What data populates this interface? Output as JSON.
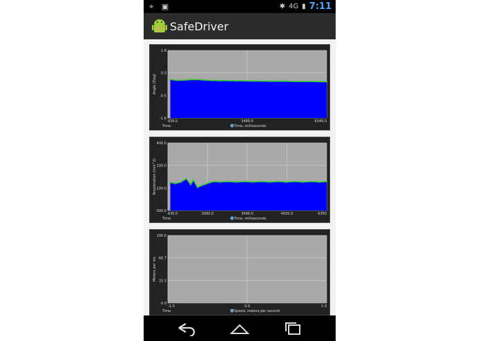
{
  "status_bar": {
    "left_icons": [
      "gps-icon",
      "image-icon"
    ],
    "network": "4G",
    "time": "7:11"
  },
  "action_bar": {
    "title": "SafeDriver",
    "icon": "android-icon"
  },
  "colors": {
    "fill": "#0000ff",
    "line": "#33cc33",
    "plot_bg": "#a9a9a9",
    "panel_bg": "#222222"
  },
  "navigation": {
    "buttons": [
      "back-icon",
      "home-icon",
      "recent-apps-icon"
    ]
  },
  "chart_data": [
    {
      "type": "area",
      "ylabel": "Angle (Deg)",
      "xlabel": "Time",
      "legend": "Time, milliseconds",
      "xlim": [
        630.0,
        6349.0
      ],
      "ylim": [
        -1.6,
        1.6
      ],
      "x_ticks": [
        "630.0",
        "3489.5",
        "6349.0"
      ],
      "y_ticks": [
        "1.6",
        "0.5",
        "-0.5",
        "-1.6"
      ],
      "x": [
        720,
        1000,
        1300,
        1600,
        1900,
        2200,
        2500,
        2800,
        3100,
        3400,
        3700,
        4000,
        4300,
        4600,
        4900,
        5200,
        5500,
        5800,
        6100,
        6349
      ],
      "values": [
        0.22,
        0.18,
        0.2,
        0.22,
        0.2,
        0.18,
        0.17,
        0.17,
        0.16,
        0.16,
        0.15,
        0.15,
        0.14,
        0.14,
        0.14,
        0.13,
        0.13,
        0.13,
        0.12,
        0.12
      ]
    },
    {
      "type": "area",
      "ylabel": "Acceleration (m/s^2)",
      "xlabel": "Time",
      "legend": "Time, milliseconds",
      "xlim": [
        630.0,
        6350.0
      ],
      "ylim": [
        -300.0,
        400.0
      ],
      "x_ticks": [
        "630.0",
        "2060.0",
        "3490.0",
        "4920.0",
        "6350"
      ],
      "y_ticks": [
        "400.0",
        "100.0",
        "-100.0",
        "-300.0"
      ],
      "x": [
        720,
        900,
        1100,
        1300,
        1450,
        1550,
        1700,
        1850,
        2000,
        2150,
        2300,
        2500,
        2800,
        3100,
        3400,
        3700,
        4000,
        4300,
        4600,
        4900,
        5200,
        5500,
        5800,
        6100,
        6350
      ],
      "values": [
        -10,
        -20,
        -5,
        30,
        -30,
        15,
        -60,
        -40,
        -25,
        -10,
        0,
        -5,
        0,
        -5,
        0,
        -5,
        0,
        -5,
        0,
        -5,
        0,
        -5,
        0,
        -5,
        0
      ]
    },
    {
      "type": "line",
      "ylabel": "Meters per ms",
      "xlabel": "Time",
      "legend": "Speed, meters per second",
      "xlim": [
        -1.0,
        1.0
      ],
      "ylim": [
        0.0,
        100.0
      ],
      "x_ticks": [
        "-1.0",
        "0.0",
        "1.0"
      ],
      "y_ticks": [
        "100.0",
        "66.7",
        "33.3",
        "0.0"
      ],
      "x": [],
      "values": []
    }
  ]
}
